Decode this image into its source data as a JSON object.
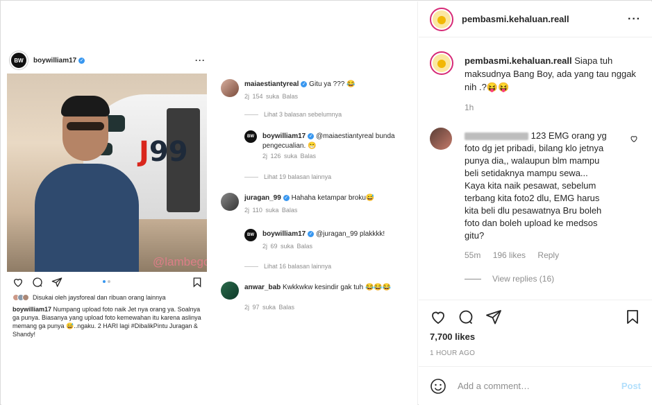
{
  "screenshot": {
    "post_user": "boywilliam17",
    "avatar_text": "BW",
    "plane_text": "99",
    "watermark": "@lambegosiip",
    "liked_by": "Disukai oleh jaysforeal dan ribuan orang lainnya",
    "caption_user": "boywilliam17",
    "caption_text": "Numpang upload foto naik Jet nya orang ya. Soalnya ga punya. Biasanya yang upload foto kemewahan itu karena aslinya memang ga punya 😅..ngaku. 2 HARI lagi #DibalikPintu Juragan & Shandy!",
    "comments": [
      {
        "user": "maiaestiantyreal",
        "text": "Gitu ya ??? 😂",
        "meta": "2j   154 suka   Balas"
      },
      {
        "reply": "Lihat 3 balasan sebelumnya"
      },
      {
        "user": "boywilliam17",
        "text": "@maiaestiantyreal bunda pengecualian. 😁",
        "meta": "2j   126 suka   Balas"
      },
      {
        "reply": "Lihat 19 balasan lainnya"
      },
      {
        "user": "juragan_99",
        "text": "Hahaha ketampar broku😅",
        "meta": "2j   110 suka   Balas"
      },
      {
        "user": "boywilliam17",
        "text": "@juragan_99 plakkkk!",
        "meta": "2j   69 suka   Balas"
      },
      {
        "reply": "Lihat 16 balasan lainnya"
      },
      {
        "user": "anwar_bab",
        "text": "Kwkkwkw kesindir gak tuh 😂😂😂",
        "meta": "2j   97 suka   Balas"
      }
    ]
  },
  "panel": {
    "username": "pembasmi.kehaluan.reall",
    "caption_text": "Siapa tuh maksudnya Bang Boy, ada yang tau nggak nih .?😝😝",
    "caption_time": "1h",
    "comment_text": "123 EMG orang yg foto dg jet pribadi, bilang klo jetnya punya dia,, walaupun blm mampu beli setidaknya mampu sewa... Kaya kita naik pesawat, sebelum terbang kita foto2 dlu, EMG harus kita beli dlu pesawatnya Bru boleh foto dan boleh upload ke medsos gitu?",
    "comment_time": "55m",
    "comment_likes": "196 likes",
    "comment_reply": "Reply",
    "view_replies": "View replies (16)",
    "likes": "7,700 likes",
    "time_ago": "1 HOUR AGO",
    "add_comment_placeholder": "Add a comment…",
    "post_label": "Post"
  }
}
